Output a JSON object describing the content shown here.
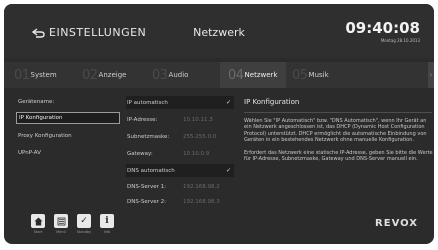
{
  "header": {
    "back_label": "EINSTELLUNGEN",
    "title": "Netzwerk",
    "time": "09:40:08",
    "date": "Montag 28.10.2013"
  },
  "tabs": [
    {
      "num": "01",
      "label": "System",
      "active": false
    },
    {
      "num": "02",
      "label": "Anzeige",
      "active": false
    },
    {
      "num": "03",
      "label": "Audio",
      "active": false
    },
    {
      "num": "04",
      "label": "Netzwerk",
      "active": true
    },
    {
      "num": "05",
      "label": "Musik",
      "active": false
    }
  ],
  "left_list": [
    {
      "label": "Gerätename:",
      "selected": false
    },
    {
      "label": "IP Konfiguration",
      "selected": true
    },
    {
      "label": "Proxy Konfiguration",
      "selected": false
    },
    {
      "label": "UPnP-AV",
      "selected": false
    }
  ],
  "ip_config": {
    "ip_auto_label": "IP automatisch",
    "ip_auto_checked": "✓",
    "fields": [
      {
        "label": "IP-Adresse:",
        "value": "10.10.11.3"
      },
      {
        "label": "Subnetzmaske:",
        "value": "255.255.0.0"
      },
      {
        "label": "Gateway:",
        "value": "10.10.0.9"
      }
    ],
    "dns_auto_label": "DNS automatisch",
    "dns_auto_checked": "✓",
    "dns_fields": [
      {
        "label": "DNS-Server 1:",
        "value": "192.168.98.2"
      },
      {
        "label": "DNS-Server 2:",
        "value": "192.168.98.3"
      }
    ]
  },
  "info": {
    "title": "IP Konfiguration",
    "para1": "Wählen Sie \"IP Automatisch\" bzw. \"DNS Automatisch\", wenn Ihr Gerät an ein Netzwerk angeschlossen ist, das DHCP (Dynamic Host Configuration Protocol) unterstützt. DHCP ermöglicht die automatische Einbindung von Geräten in ein bestehendes Netzwerk ohne manuelle Konfiguration.",
    "para2": "Erfordert das Netzwerk eine statische IP-Adresse, geben Sie bitte die Werte für IP-Adresse, Subnetzmaske, Gateway und DNS-Server manuell ein."
  },
  "bottom": {
    "buttons": [
      {
        "icon": "home-icon",
        "label": "Start"
      },
      {
        "icon": "menu-icon",
        "label": "Menü"
      },
      {
        "icon": "checkmark-icon",
        "label": "Standby"
      },
      {
        "icon": "info-icon",
        "label": "Info"
      }
    ],
    "brand": "REVOX"
  }
}
